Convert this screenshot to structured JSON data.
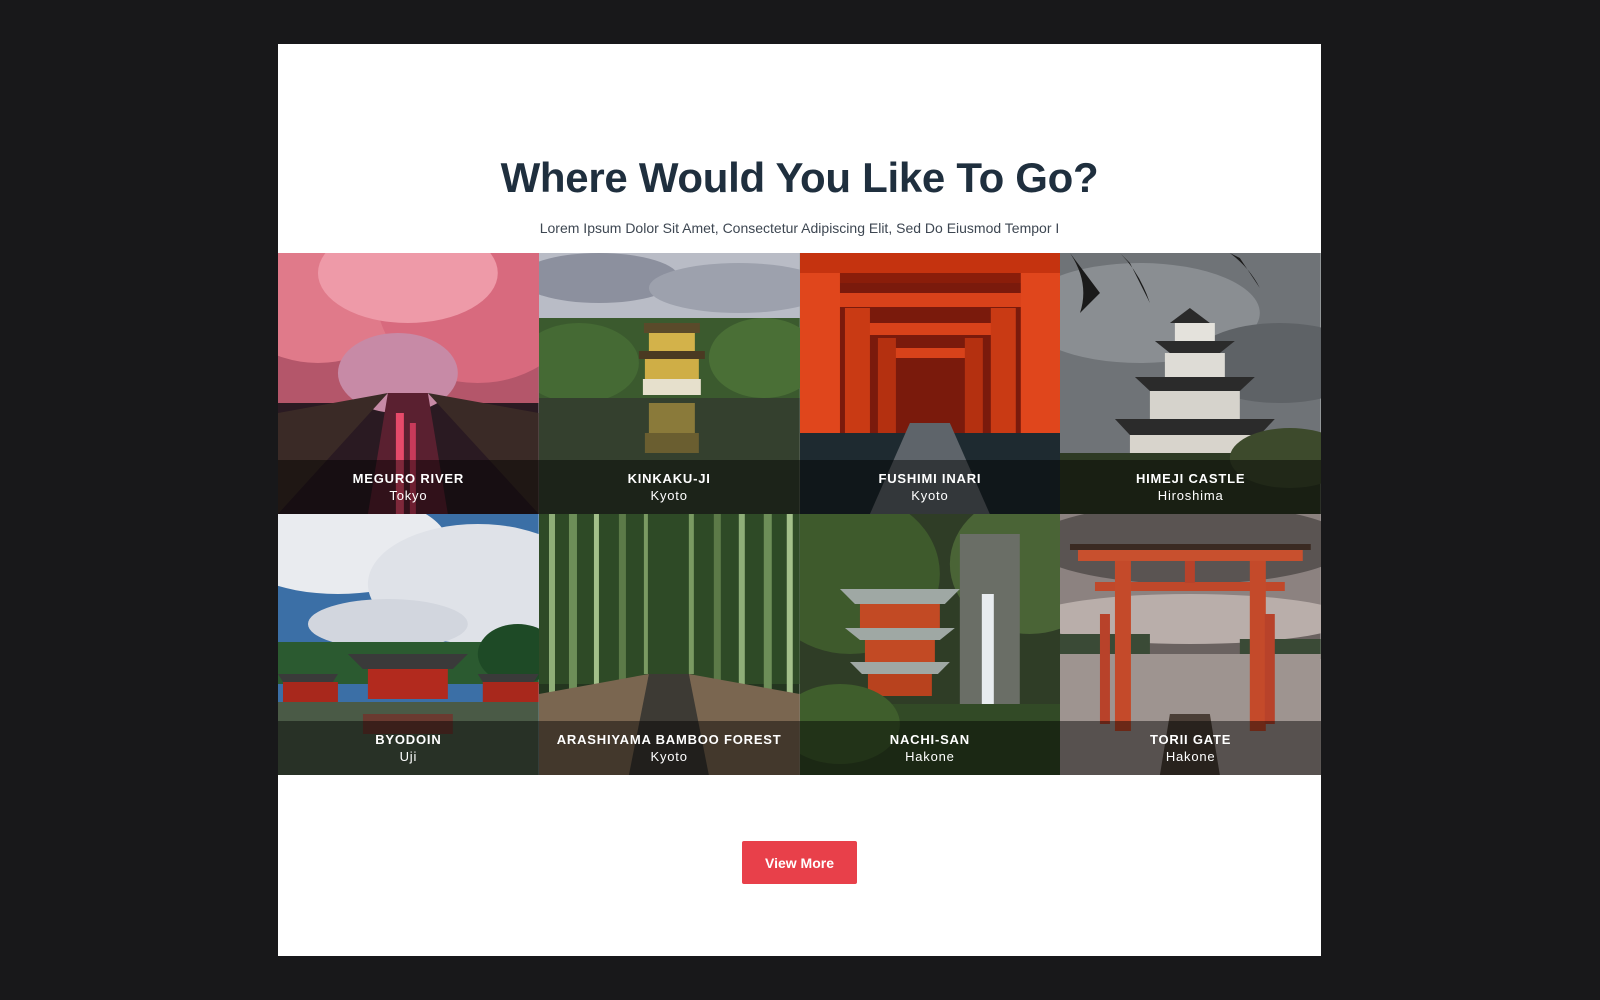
{
  "section": {
    "title": "Where Would You Like To Go?",
    "subtitle": "Lorem Ipsum Dolor Sit Amet, Consectetur Adipiscing Elit, Sed Do Eiusmod Tempor I"
  },
  "destinations": [
    {
      "name": "MEGURO RIVER",
      "city": "Tokyo"
    },
    {
      "name": "KINKAKU-JI",
      "city": "Kyoto"
    },
    {
      "name": "FUSHIMI INARI",
      "city": "Kyoto"
    },
    {
      "name": "HIMEJI CASTLE",
      "city": "Hiroshima"
    },
    {
      "name": "BYODOIN",
      "city": "Uji"
    },
    {
      "name": "ARASHIYAMA BAMBOO FOREST",
      "city": "Kyoto"
    },
    {
      "name": "NACHI-SAN",
      "city": "Hakone"
    },
    {
      "name": "TORII GATE",
      "city": "Hakone"
    }
  ],
  "button": {
    "label": "View More"
  },
  "colors": {
    "page_bg": "#18181a",
    "card_bg": "#ffffff",
    "title": "#1f2f3e",
    "accent": "#e8404a"
  }
}
